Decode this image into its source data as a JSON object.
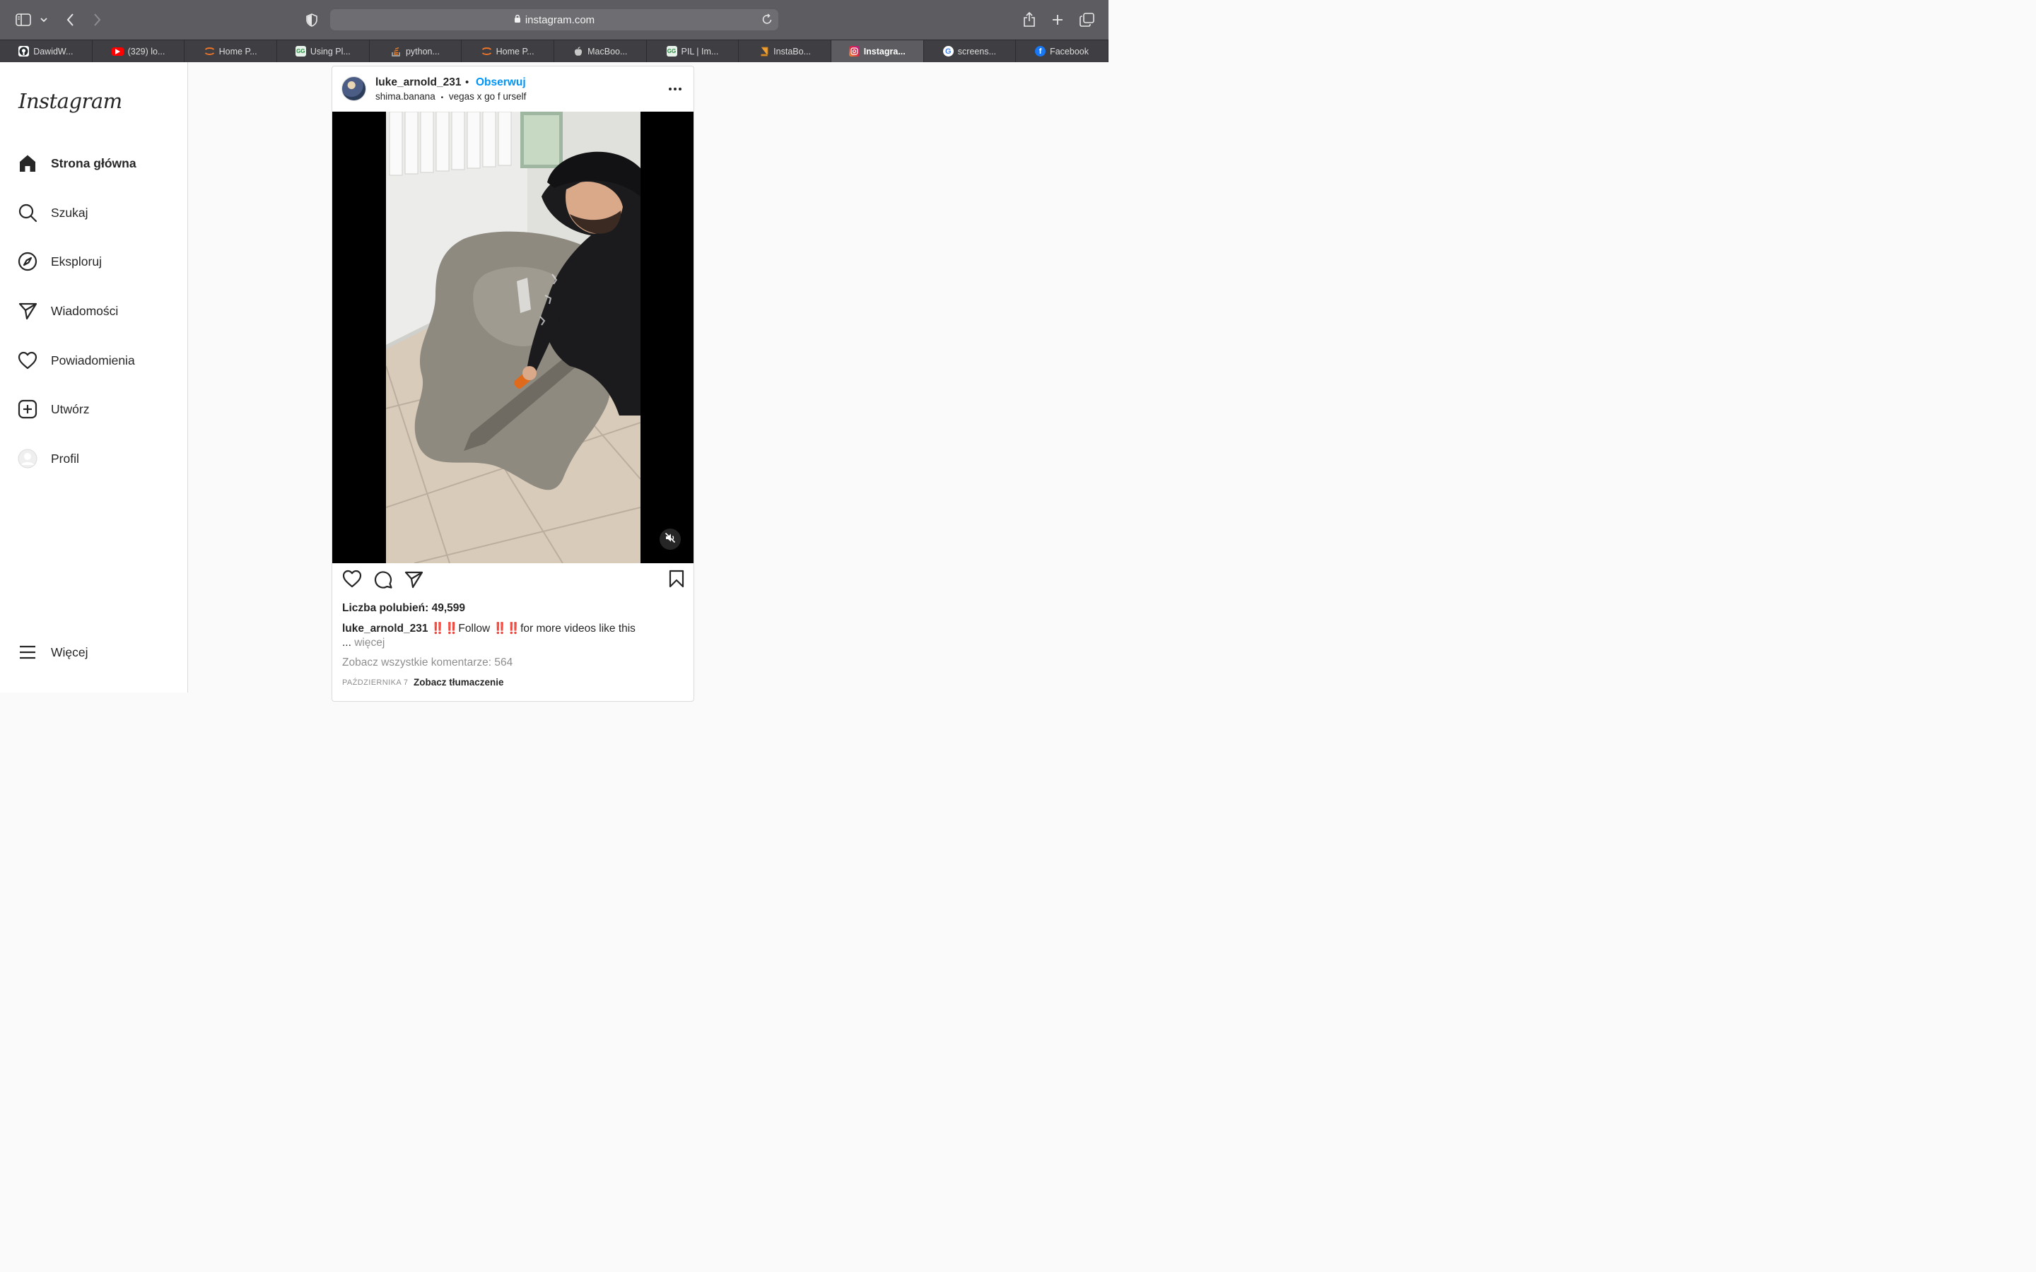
{
  "browser": {
    "url": "instagram.com",
    "tabs": [
      {
        "label": "DawidW...",
        "favicon": "github-icon",
        "color": "#24292e"
      },
      {
        "label": "(329) lo...",
        "favicon": "youtube-icon",
        "color": "#ff0000"
      },
      {
        "label": "Home P...",
        "favicon": "jupyter-icon",
        "color": "#f37726"
      },
      {
        "label": "Using Pl...",
        "favicon": "geeksforgeeks-icon",
        "color": "#2f8d46"
      },
      {
        "label": "python...",
        "favicon": "stackoverflow-icon",
        "color": "#f48024"
      },
      {
        "label": "Home P...",
        "favicon": "jupyter-icon",
        "color": "#f37726"
      },
      {
        "label": "MacBoo...",
        "favicon": "apple-icon",
        "color": "#a2aaad"
      },
      {
        "label": "PIL | Im...",
        "favicon": "geeksforgeeks-icon",
        "color": "#2f8d46"
      },
      {
        "label": "InstaBo...",
        "favicon": "book-icon",
        "color": "#f0a030"
      },
      {
        "label": "Instagra...",
        "favicon": "instagram-icon",
        "color": "#d6249f"
      },
      {
        "label": "screens...",
        "favicon": "google-icon",
        "color": "#4285f4"
      },
      {
        "label": "Facebook",
        "favicon": "facebook-icon",
        "color": "#1877f2"
      }
    ],
    "active_tab": 9
  },
  "sidebar": {
    "logo": "Instagram",
    "items": [
      {
        "label": "Strona główna",
        "icon": "home-icon"
      },
      {
        "label": "Szukaj",
        "icon": "search-icon"
      },
      {
        "label": "Eksploruj",
        "icon": "compass-icon"
      },
      {
        "label": "Wiadomości",
        "icon": "send-icon"
      },
      {
        "label": "Powiadomienia",
        "icon": "heart-icon"
      },
      {
        "label": "Utwórz",
        "icon": "plus-square-icon"
      },
      {
        "label": "Profil",
        "icon": "profile-avatar"
      }
    ],
    "more": {
      "label": "Więcej",
      "icon": "menu-icon"
    }
  },
  "post": {
    "username": "luke_arnold_231",
    "separator": "•",
    "follow_label": "Obserwuj",
    "audio_user": "shima.banana",
    "audio_separator": "•",
    "audio_track": "vegas x go f urself",
    "likes_label": "Liczba polubień: 49,599",
    "caption_user": "luke_arnold_231",
    "caption_bang1": "‼️‼️",
    "caption_text1": "Follow",
    "caption_bang2": "‼️‼️",
    "caption_text2": "for more videos like this",
    "caption_ellipsis": "...",
    "caption_more": "więcej",
    "comments_label": "Zobacz wszystkie komentarze: 564",
    "date": "PAŹDZIERNIKA 7",
    "translate_label": "Zobacz tłumaczenie"
  }
}
